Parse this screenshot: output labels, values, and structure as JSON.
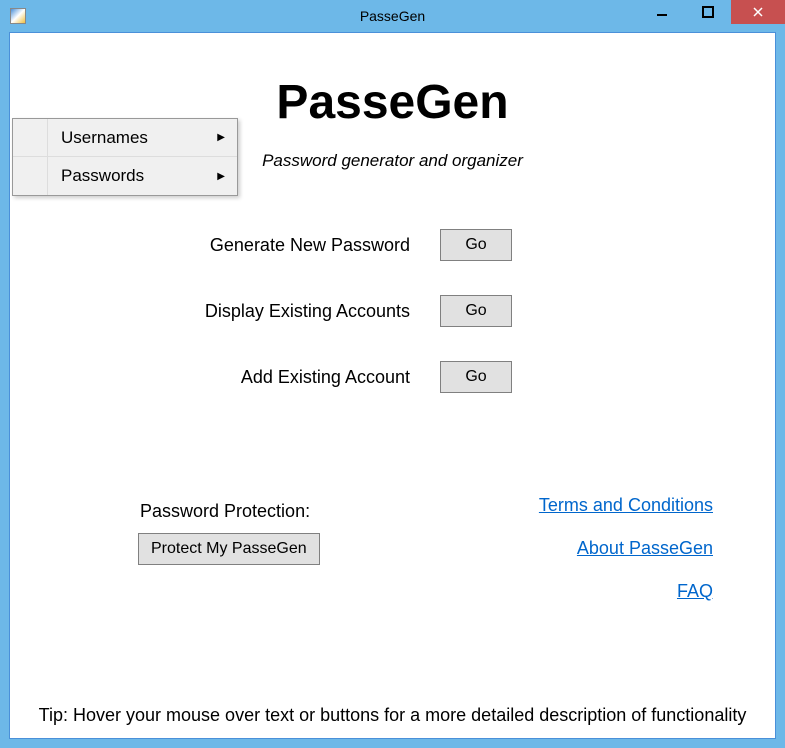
{
  "window": {
    "title": "PasseGen"
  },
  "menu": {
    "items": [
      {
        "label": "Usernames"
      },
      {
        "label": "Passwords"
      }
    ]
  },
  "header": {
    "title": "PasseGen",
    "subtitle": "Password generator and organizer"
  },
  "actions": {
    "generate": {
      "label": "Generate New Password",
      "button": "Go"
    },
    "display": {
      "label": "Display Existing Accounts",
      "button": "Go"
    },
    "add": {
      "label": "Add Existing Account",
      "button": "Go"
    }
  },
  "protection": {
    "label": "Password Protection:",
    "button": "Protect My PasseGen"
  },
  "links": {
    "terms": "Terms and Conditions",
    "about": "About PasseGen",
    "faq": "FAQ"
  },
  "tip": "Tip: Hover your mouse over text or buttons for a more detailed description of functionality"
}
